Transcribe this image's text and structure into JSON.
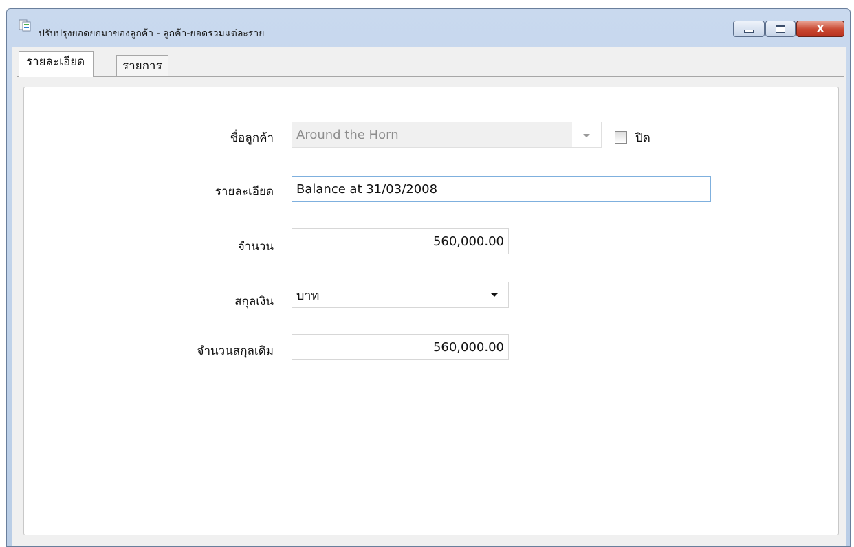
{
  "window": {
    "title": "ปรับปรุงยอดยกมาของลูกค้า - ลูกค้า-ยอดรวมแต่ละราย",
    "icon": "document-app-icon",
    "controls": {
      "minimize": "minimize-icon",
      "maximize": "maximize-icon",
      "close_glyph": "X"
    }
  },
  "tabs": [
    {
      "label": "รายละเอียด",
      "active": true
    },
    {
      "label": "รายการ",
      "active": false
    }
  ],
  "form": {
    "customer": {
      "label": "ชื่อลูกค้า",
      "value": "Around the Horn",
      "disabled": true
    },
    "closed": {
      "label": "ปิด",
      "checked": false
    },
    "description": {
      "label": "รายละเอียด",
      "value": "Balance at 31/03/2008"
    },
    "amount": {
      "label": "จำนวน",
      "value": "560,000.00"
    },
    "currency": {
      "label": "สกุลเงิน",
      "value": "บาท"
    },
    "original_amount": {
      "label": "จำนวนสกุลเดิม",
      "value": "560,000.00"
    }
  },
  "colors": {
    "titlebar": "#c9d9ee",
    "close_button": "#c8462f",
    "focus_border": "#7fb0de"
  }
}
